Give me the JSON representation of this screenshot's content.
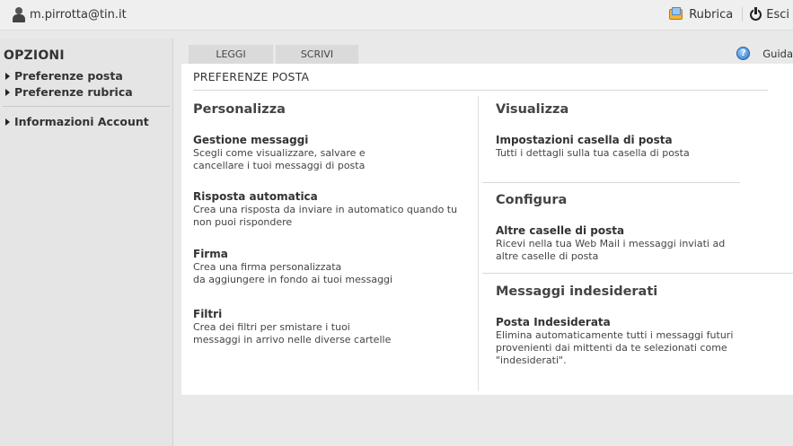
{
  "topbar": {
    "user_email": "m.pirrotta@tin.it",
    "rubrica_label": "Rubrica",
    "esci_label": "Esci"
  },
  "sidebar": {
    "title": "OPZIONI",
    "items": [
      {
        "label": "Preferenze posta"
      },
      {
        "label": "Preferenze rubrica"
      },
      {
        "label": "Informazioni Account"
      }
    ]
  },
  "tabs": [
    {
      "label": "LEGGI"
    },
    {
      "label": "SCRIVI"
    }
  ],
  "help": {
    "label": "Guida"
  },
  "panel": {
    "title": "PREFERENZE POSTA",
    "left": {
      "heading": "Personalizza",
      "entries": [
        {
          "title": "Gestione messaggi",
          "desc": "Scegli come visualizzare, salvare e\ncancellare i tuoi messaggi di posta"
        },
        {
          "title": "Risposta automatica",
          "desc": "Crea una risposta da inviare in automatico quando tu\nnon puoi rispondere"
        },
        {
          "title": "Firma",
          "desc": "Crea una firma personalizzata\nda aggiungere in fondo ai tuoi messaggi"
        },
        {
          "title": "Filtri",
          "desc": "Crea dei filtri per smistare i tuoi\nmessaggi in arrivo nelle diverse cartelle"
        }
      ]
    },
    "right": {
      "sections": [
        {
          "heading": "Visualizza",
          "title": "Impostazioni casella di posta",
          "desc": "Tutti i dettagli sulla tua casella di posta"
        },
        {
          "heading": "Configura",
          "title": "Altre caselle di posta",
          "desc": "Ricevi nella tua Web Mail i messaggi inviati ad\naltre caselle di posta"
        },
        {
          "heading": "Messaggi indesiderati",
          "title": "Posta Indesiderata",
          "desc": "Elimina automaticamente tutti i messaggi futuri\nprovenienti dai mittenti da te selezionati come\n\"indesiderati\"."
        }
      ]
    }
  }
}
